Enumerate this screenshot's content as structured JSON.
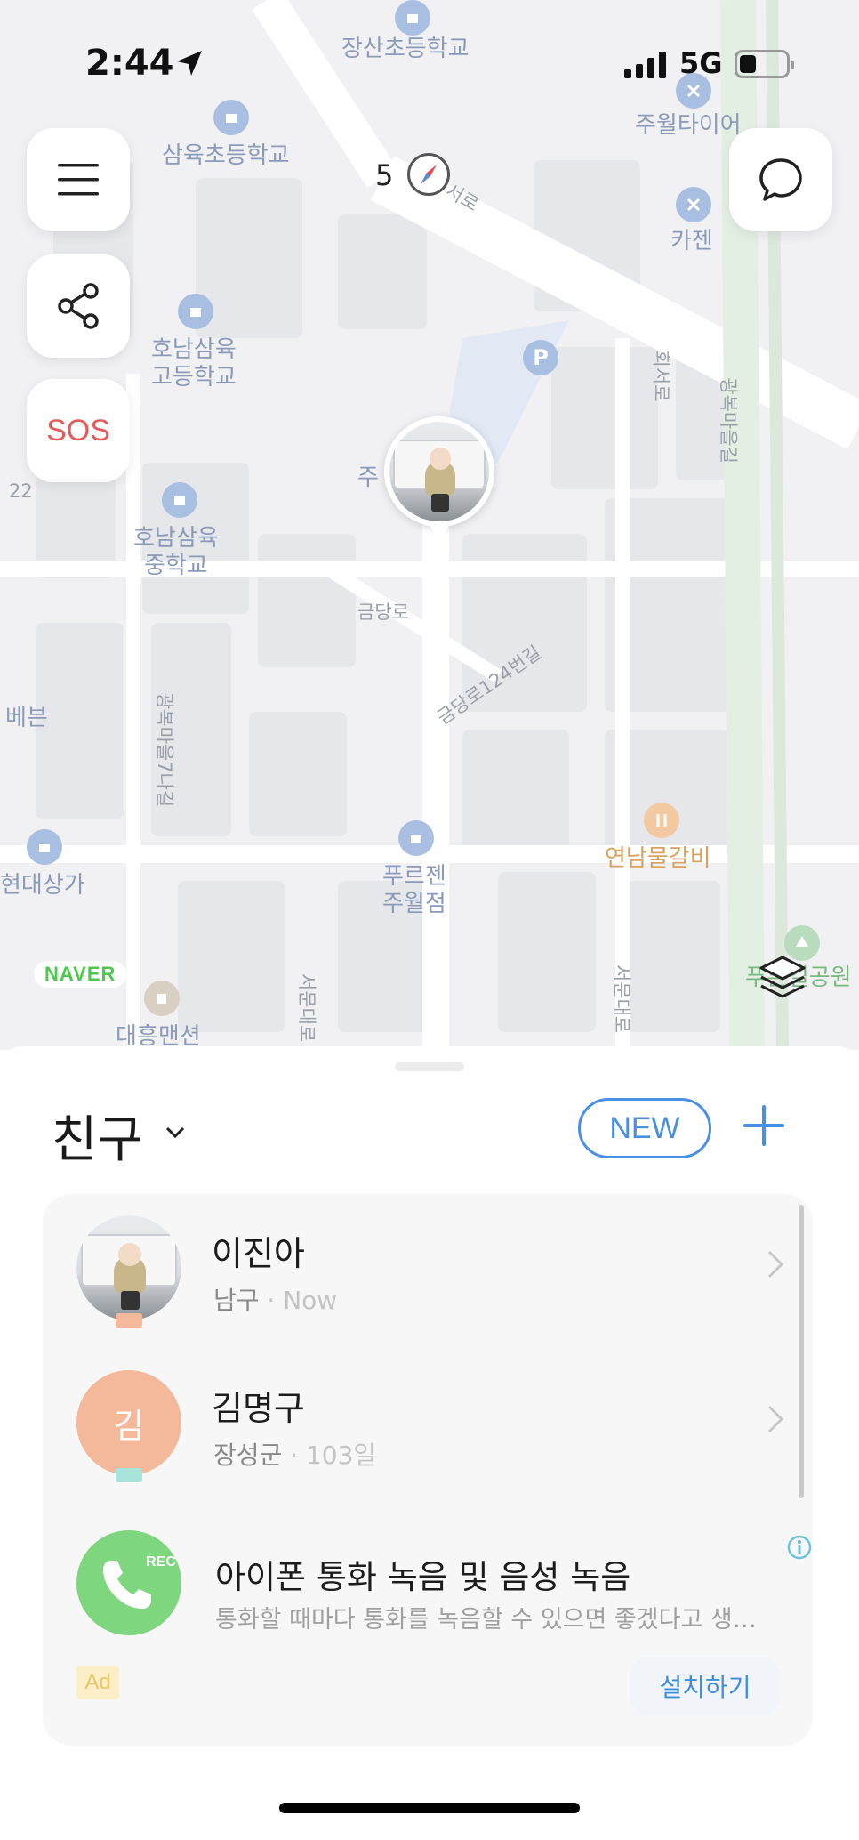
{
  "status_bar": {
    "time": "2:44",
    "network": "5G"
  },
  "map": {
    "compass_value": "5",
    "labels": {
      "school_jangsan": "장산초등학교",
      "school_samyuk": "삼육초등학교",
      "highschool_honam": "호남삼육\n고등학교",
      "middleschool_honam": "호남삼육\n중학교",
      "tire_shop": "주월타이어",
      "kajen": "카젠",
      "frozen": "푸르젠\n주월점",
      "restaurant": "연남물갈비",
      "shopping": "현대상가",
      "mansion": "대흥맨션",
      "road_geumdang": "금당로",
      "road_124": "금당로124번길",
      "road_7": "광복마을7나길",
      "road_hoeseo": "회서로",
      "road_gwangbok": "광복마을길",
      "road_seomun": "서문대로",
      "road_seomun2": "서문대로",
      "road_seo": "서로",
      "park": "푸른길공원",
      "partial_left": "베븐",
      "partial_22": "22",
      "partial_ju": "주"
    },
    "naver_logo": "NAVER"
  },
  "buttons": {
    "sos": "SOS"
  },
  "sheet": {
    "title": "친구",
    "new_label": "NEW",
    "friends": [
      {
        "name": "이진아",
        "place": "남구",
        "separator": " · ",
        "when": "Now",
        "tag_color": "#f4b89a"
      },
      {
        "name": "김명구",
        "initial": "김",
        "place": "장성군",
        "separator": " · ",
        "when": "103일",
        "tag_color": "#a8e4dc"
      }
    ],
    "ad": {
      "icon_text": "REC",
      "title": "아이폰 통화 녹음 및 음성 녹음",
      "description": "통화할 때마다 통화를 녹음할 수 있으면 좋겠다고 생…",
      "badge": "Ad",
      "install_label": "설치하기"
    }
  },
  "colors": {
    "accent": "#4a90e2",
    "sos": "#e35b5b",
    "naver": "#4dc94d"
  }
}
